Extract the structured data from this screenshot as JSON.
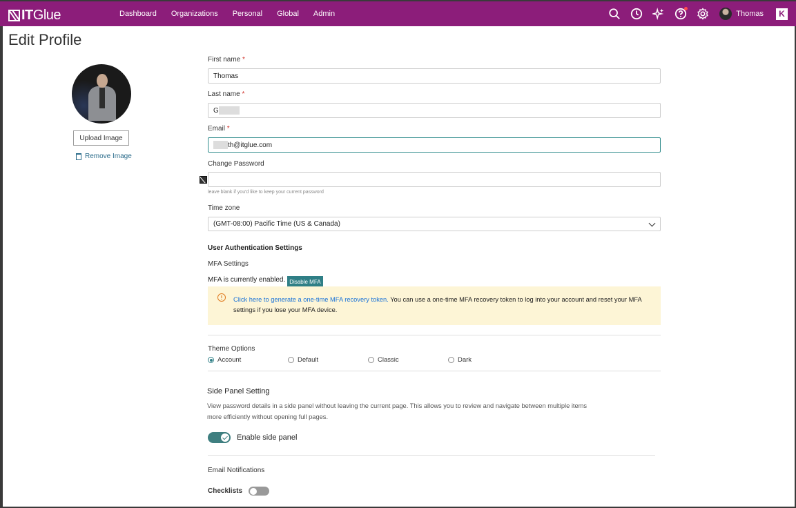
{
  "nav": {
    "logo_it": "IT",
    "logo_glue": "Glue",
    "links": [
      "Dashboard",
      "Organizations",
      "Personal",
      "Global",
      "Admin"
    ],
    "user_name": "Thomas",
    "k_badge": "K",
    "icons": [
      "search-icon",
      "clock-icon",
      "sparkle-icon",
      "help-icon",
      "gear-icon"
    ]
  },
  "page": {
    "title": "Edit Profile"
  },
  "avatar": {
    "upload_label": "Upload Image",
    "remove_label": "Remove Image"
  },
  "form": {
    "first_name_label": "First name",
    "first_name_value": "Thomas",
    "last_name_label": "Last name",
    "last_name_value": "G",
    "email_label": "Email",
    "email_value": "th@itglue.com",
    "password_label": "Change Password",
    "password_hint": "leave blank if you'd like to keep your current password",
    "timezone_label": "Time zone",
    "timezone_value": "(GMT-08:00) Pacific Time (US & Canada)",
    "required_mark": "*"
  },
  "auth": {
    "section_title": "User Authentication Settings",
    "mfa_title": "MFA Settings",
    "mfa_status": "MFA is currently enabled.",
    "mfa_button": "Disable MFA",
    "alert_link": "Click here to generate a one-time MFA recovery token.",
    "alert_text": " You can use a one-time MFA recovery token to log into your account and reset your MFA settings if you lose your MFA device."
  },
  "theme": {
    "title": "Theme Options",
    "options": [
      "Account",
      "Default",
      "Classic",
      "Dark"
    ],
    "selected": "Account"
  },
  "side_panel": {
    "title": "Side Panel Setting",
    "description": "View password details in a side panel without leaving the current page. This allows you to review and navigate between multiple items more efficiently without opening full pages.",
    "toggle_label": "Enable side panel",
    "enabled": true
  },
  "notifications": {
    "title": "Email Notifications",
    "checklists_label": "Checklists",
    "checklists_enabled": false
  },
  "colors": {
    "nav_bg": "#8c1d7a",
    "accent": "#2f7f86",
    "alert_bg": "#fdf5d6",
    "link": "#1a73d8"
  }
}
